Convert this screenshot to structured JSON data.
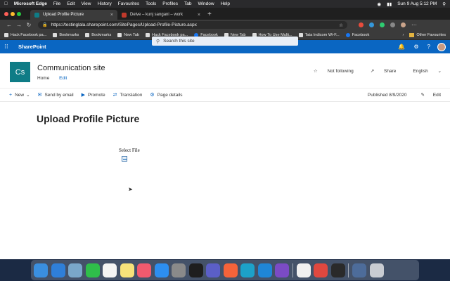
{
  "menubar": {
    "app": "Microsoft Edge",
    "items": [
      "File",
      "Edit",
      "View",
      "History",
      "Favourites",
      "Tools",
      "Profiles",
      "Tab",
      "Window",
      "Help"
    ],
    "clock": "Sun 9 Aug  5:12 PM"
  },
  "browser": {
    "tabs": [
      {
        "label": "Upload Profile Picture",
        "favicon_color": "#0f7c86"
      },
      {
        "label": "Delve – kunj sangani – work",
        "favicon_color": "#c0392b"
      }
    ],
    "new_tab_glyph": "+",
    "url": "https://testinglala.sharepoint.com/SitePages/Upload-Profile-Picture.aspx",
    "bookmarks": [
      {
        "label": "Hack Facebook pa...",
        "icon": "page-icon"
      },
      {
        "label": "Bookmarks",
        "icon": "page-icon"
      },
      {
        "label": "Bookmarks",
        "icon": "page-icon"
      },
      {
        "label": "New Tab",
        "icon": "page-icon"
      },
      {
        "label": "Hack Facebook pa...",
        "icon": "page-icon"
      },
      {
        "label": "Facebook",
        "icon": "facebook-icon"
      },
      {
        "label": "New Tab",
        "icon": "page-icon"
      },
      {
        "label": "How To Use Multi...",
        "icon": "page-icon"
      },
      {
        "label": "Tata Indicom Wi-F...",
        "icon": "page-icon"
      },
      {
        "label": "Facebook",
        "icon": "facebook-icon"
      }
    ],
    "other_favourites": "Other Favourites"
  },
  "suitebar": {
    "app_name": "SharePoint",
    "search_placeholder": "Search this site",
    "accent": "#0a66c2"
  },
  "site": {
    "logo_text": "Cs",
    "logo_color": "#0f7c86",
    "name": "Communication site",
    "nav": [
      "Home",
      "Edit"
    ],
    "actions": {
      "follow": "Not following",
      "share": "Share",
      "language": "English"
    }
  },
  "commandbar": {
    "items": [
      {
        "label": "New",
        "icon": "plus-icon"
      },
      {
        "label": "Send by email",
        "icon": "mail-icon"
      },
      {
        "label": "Promote",
        "icon": "megaphone-icon"
      },
      {
        "label": "Translation",
        "icon": "translate-icon"
      },
      {
        "label": "Page details",
        "icon": "gear-icon"
      }
    ],
    "published": "Published 8/9/2020",
    "edit": "Edit"
  },
  "page": {
    "title": "Upload Profile Picture",
    "select_file_label": "Select File"
  },
  "dock": {
    "apps": [
      "finder-icon",
      "safari-icon",
      "preview-icon",
      "facetime-icon",
      "calendar-icon",
      "notes-icon",
      "music-icon",
      "appstore-icon",
      "system-preferences-icon",
      "terminal-icon",
      "teams-icon",
      "swift-icon",
      "edge-icon",
      "xcode-icon",
      "visual-studio-icon",
      "textedit-icon",
      "remote-desktop-icon",
      "obs-icon",
      "downloads-icon",
      "trash-icon"
    ]
  }
}
